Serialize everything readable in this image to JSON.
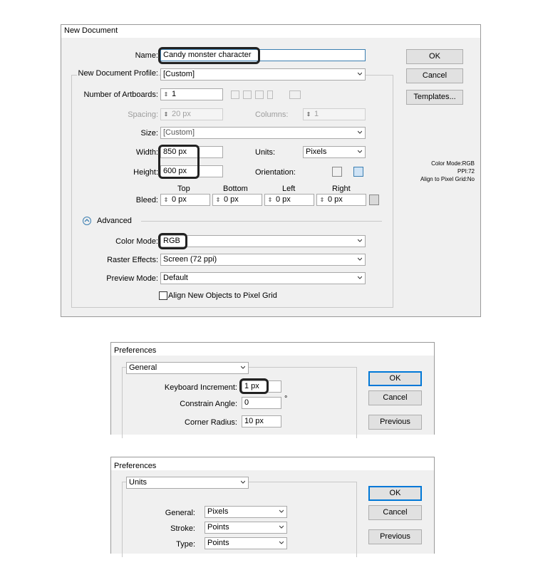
{
  "new_doc": {
    "title": "New Document",
    "name_label": "Name:",
    "name_value": "Candy monster character",
    "profile_label": "New Document Profile:",
    "profile_value": "[Custom]",
    "artboards_label": "Number of Artboards:",
    "artboards_value": "1",
    "spacing_label": "Spacing:",
    "spacing_value": "20 px",
    "columns_label": "Columns:",
    "columns_value": "1",
    "size_label": "Size:",
    "size_value": "[Custom]",
    "width_label": "Width:",
    "width_value": "850 px",
    "units_label": "Units:",
    "units_value": "Pixels",
    "height_label": "Height:",
    "height_value": "600 px",
    "orientation_label": "Orientation:",
    "bleed_label": "Bleed:",
    "bleed_top_label": "Top",
    "bleed_bottom_label": "Bottom",
    "bleed_left_label": "Left",
    "bleed_right_label": "Right",
    "bleed_top": "0 px",
    "bleed_bottom": "0 px",
    "bleed_left": "0 px",
    "bleed_right": "0 px",
    "advanced_label": "Advanced",
    "color_mode_label": "Color Mode:",
    "color_mode_value": "RGB",
    "raster_label": "Raster Effects:",
    "raster_value": "Screen (72 ppi)",
    "preview_label": "Preview Mode:",
    "preview_value": "Default",
    "align_label": "Align New Objects to Pixel Grid",
    "ok": "OK",
    "cancel": "Cancel",
    "templates": "Templates...",
    "info_color_mode": "Color Mode:RGB",
    "info_ppi": "PPI:72",
    "info_align": "Align to Pixel Grid:No"
  },
  "prefs_general": {
    "title": "Preferences",
    "section": "General",
    "keyboard_label": "Keyboard Increment:",
    "keyboard_value": "1 px",
    "constrain_label": "Constrain Angle:",
    "constrain_value": "0",
    "degree": "°",
    "corner_label": "Corner Radius:",
    "corner_value": "10 px",
    "ok": "OK",
    "cancel": "Cancel",
    "previous": "Previous"
  },
  "prefs_units": {
    "title": "Preferences",
    "section": "Units",
    "general_label": "General:",
    "general_value": "Pixels",
    "stroke_label": "Stroke:",
    "stroke_value": "Points",
    "type_label": "Type:",
    "type_value": "Points",
    "ok": "OK",
    "cancel": "Cancel",
    "previous": "Previous"
  },
  "colors": {
    "highlight": "#222222",
    "default_button_border": "#0078d7",
    "window_bg": "#f0f0f0"
  }
}
